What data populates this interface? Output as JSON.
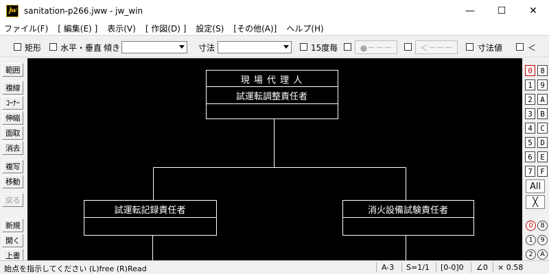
{
  "window": {
    "app_icon": "jw",
    "title": "sanitation-p266.jww - jw_win",
    "minimize_glyph": "—",
    "maximize_glyph": "☐",
    "close_glyph": "✕"
  },
  "menu": [
    "ファイル(F)",
    "[ 編集(E) ]",
    "表示(V)",
    "[ 作図(D) ]",
    "設定(S)",
    "[その他(A)]",
    "ヘルプ(H)"
  ],
  "toolbar": {
    "rect_label": "矩形",
    "hv_label": "水平・垂直",
    "tilt_label": "傾き",
    "tilt_value": "",
    "dim_label": "寸法",
    "dim_value": "",
    "deg15_label": "15度毎",
    "btn_dot_label": "●－－－",
    "btn_arrow_label": "＜－－－",
    "dimval_label": "寸法値",
    "lt_label": "＜"
  },
  "tools": [
    "範囲",
    "複線",
    "ｺｰﾅｰ",
    "伸縮",
    "面取",
    "消去",
    "複写",
    "移動",
    "戻る",
    "新規",
    "開く",
    "上書"
  ],
  "canvas": {
    "top_box_line1": "現 場  代 理 人",
    "top_box_line2": "試運転調整責任者",
    "left_box_line1": "試運転記録責任者",
    "right_box_line1": "消火設備試験責任者"
  },
  "layers": {
    "left": [
      "0",
      "1",
      "2",
      "3",
      "4",
      "5",
      "6",
      "7"
    ],
    "right": [
      "8",
      "9",
      "A",
      "B",
      "C",
      "D",
      "E",
      "F"
    ],
    "all_label": "All",
    "close_label": "╳",
    "groups_left": [
      "0",
      "1",
      "2"
    ],
    "groups_right": [
      "8",
      "9",
      "A"
    ]
  },
  "status": {
    "message": "始点を指示してください (L)free (R)Read",
    "paper": "A-3",
    "scale": "S=1/1",
    "layer": "[0-0]0",
    "angle": "∠0",
    "zoom": "× 0.58"
  },
  "colors": {
    "canvas_bg": "#000000",
    "drawing_line": "#ffffff",
    "active_layer": "#c00000"
  }
}
